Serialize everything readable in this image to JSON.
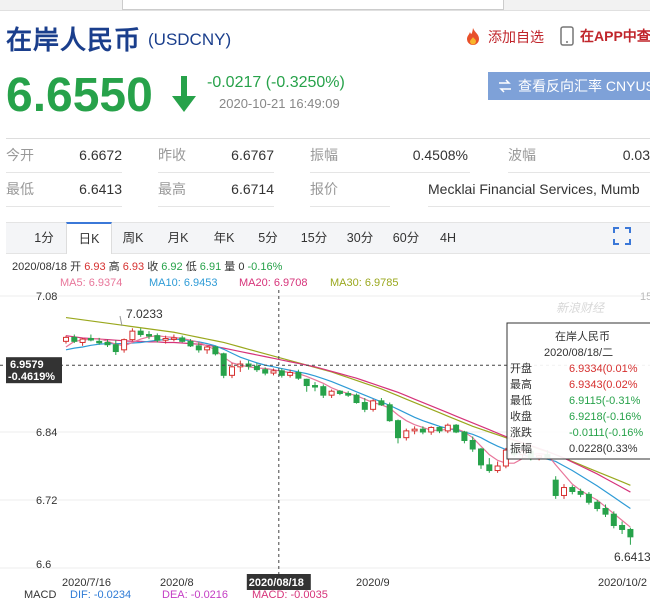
{
  "header": {
    "title": "在岸人民币",
    "code": "(USDCNY)",
    "fav_label": "添加自选",
    "app_label": "在APP中查"
  },
  "quote": {
    "price": "6.6550",
    "change": "-0.0217 (-0.3250%)",
    "time": "2020-10-21 16:49:09",
    "reverse_button": "查看反向汇率 CNYUS",
    "color_down": "#27a24a"
  },
  "stats": [
    [
      {
        "label": "今开",
        "value": "6.6672"
      },
      {
        "label": "昨收",
        "value": "6.6767"
      },
      {
        "label": "振幅",
        "value": "0.4508%"
      },
      {
        "label": "波幅",
        "value": "0.03"
      }
    ],
    [
      {
        "label": "最低",
        "value": "6.6413"
      },
      {
        "label": "最高",
        "value": "6.6714"
      },
      {
        "label": "报价",
        "value": "Mecklai Financial Services, Mumb"
      }
    ]
  ],
  "tabs": [
    "1分",
    "日K",
    "周K",
    "月K",
    "年K",
    "5分",
    "15分",
    "30分",
    "60分",
    "4H"
  ],
  "active_tab": "日K",
  "chart_info": {
    "ohlc_line": {
      "date": "2020/08/18",
      "open_label": "开",
      "open": "6.93",
      "high_label": "高",
      "high": "6.93",
      "close_label": "收",
      "close": "6.92",
      "low_label": "低",
      "low": "6.91",
      "vol_label": "量",
      "vol": "0",
      "pct": "-0.16%"
    },
    "ma": [
      {
        "label": "MA5: 6.9374",
        "color": "#e8769a"
      },
      {
        "label": "MA10: 6.9453",
        "color": "#2e9bd6"
      },
      {
        "label": "MA20: 6.9708",
        "color": "#d6337a"
      },
      {
        "label": "MA30: 6.9785",
        "color": "#9aa81e"
      }
    ],
    "macd": [
      {
        "label": "MACD",
        "color": "#333"
      },
      {
        "label": "DIF: -0.0234",
        "color": "#2e7bd6"
      },
      {
        "label": "DEA: -0.0216",
        "color": "#c43dc4"
      },
      {
        "label": "MACD: -0.0035",
        "color": "#d6337a"
      }
    ],
    "cursor_price": "6.9579",
    "cursor_pct": "-0.4619%",
    "cursor_date": "2020/08/18",
    "max_label": "7.0233",
    "min_label": "6.6413",
    "watermark": "新浪财经",
    "right_edge_label": "15",
    "tooltip": {
      "title": "在岸人民币",
      "date": "2020/08/18/二",
      "rows": [
        {
          "label": "开盘",
          "value": "6.9334(0.01%"
        },
        {
          "label": "最高",
          "value": "6.9343(0.02%"
        },
        {
          "label": "最低",
          "value": "6.9115(-0.31%"
        },
        {
          "label": "收盘",
          "value": "6.9218(-0.16%"
        },
        {
          "label": "涨跌",
          "value": "-0.0111(-0.16%"
        },
        {
          "label": "振幅",
          "value": "0.0228(0.33%"
        }
      ]
    }
  },
  "chart_data": {
    "type": "candlestick",
    "yticks": [
      "7.08",
      "6.84",
      "6.72",
      "6.6"
    ],
    "xticks": [
      "2020/7/16",
      "2020/8",
      "2020/08/18",
      "2020/9",
      "2020/10/2"
    ],
    "ylim": [
      6.6,
      7.08
    ],
    "up_color": "#d6302f",
    "down_color": "#27a24a",
    "candles": [
      [
        7.0,
        7.01,
        6.996,
        7.007
      ],
      [
        7.007,
        7.012,
        6.997,
        7.0
      ],
      [
        6.998,
        7.006,
        6.992,
        7.004
      ],
      [
        7.005,
        7.012,
        7.0,
        7.003
      ],
      [
        7.0,
        7.006,
        6.994,
        6.998
      ],
      [
        6.998,
        7.003,
        6.99,
        6.994
      ],
      [
        6.994,
        7.002,
        6.976,
        6.982
      ],
      [
        6.985,
        7.005,
        6.98,
        7.003
      ],
      [
        7.003,
        7.023,
        7.0,
        7.018
      ],
      [
        7.018,
        7.023,
        7.008,
        7.012
      ],
      [
        7.012,
        7.018,
        7.004,
        7.01
      ],
      [
        7.01,
        7.014,
        6.998,
        7.002
      ],
      [
        7.002,
        7.01,
        6.996,
        7.005
      ],
      [
        7.005,
        7.012,
        7.0,
        7.006
      ],
      [
        7.006,
        7.01,
        6.998,
        7.0
      ],
      [
        7.0,
        7.004,
        6.99,
        6.992
      ],
      [
        6.992,
        6.998,
        6.98,
        6.985
      ],
      [
        6.985,
        6.992,
        6.978,
        6.99
      ],
      [
        6.99,
        6.992,
        6.975,
        6.978
      ],
      [
        6.978,
        6.98,
        6.935,
        6.94
      ],
      [
        6.94,
        6.962,
        6.935,
        6.955
      ],
      [
        6.955,
        6.966,
        6.946,
        6.96
      ],
      [
        6.96,
        6.966,
        6.95,
        6.956
      ],
      [
        6.956,
        6.962,
        6.946,
        6.95
      ],
      [
        6.95,
        6.954,
        6.94,
        6.944
      ],
      [
        6.944,
        6.952,
        6.94,
        6.948
      ],
      [
        6.948,
        6.952,
        6.936,
        6.94
      ],
      [
        6.94,
        6.95,
        6.936,
        6.945
      ],
      [
        6.945,
        6.95,
        6.932,
        6.935
      ],
      [
        6.933,
        6.934,
        6.911,
        6.922
      ],
      [
        6.922,
        6.928,
        6.912,
        6.92
      ],
      [
        6.92,
        6.924,
        6.9,
        6.905
      ],
      [
        6.905,
        6.915,
        6.9,
        6.912
      ],
      [
        6.912,
        6.914,
        6.905,
        6.908
      ],
      [
        6.908,
        6.912,
        6.902,
        6.905
      ],
      [
        6.905,
        6.908,
        6.89,
        6.892
      ],
      [
        6.892,
        6.9,
        6.875,
        6.88
      ],
      [
        6.88,
        6.898,
        6.876,
        6.895
      ],
      [
        6.895,
        6.9,
        6.886,
        6.888
      ],
      [
        6.888,
        6.892,
        6.858,
        6.86
      ],
      [
        6.86,
        6.862,
        6.82,
        6.83
      ],
      [
        6.83,
        6.846,
        6.825,
        6.842
      ],
      [
        6.842,
        6.85,
        6.836,
        6.845
      ],
      [
        6.845,
        6.85,
        6.836,
        6.84
      ],
      [
        6.84,
        6.85,
        6.835,
        6.848
      ],
      [
        6.848,
        6.85,
        6.838,
        6.842
      ],
      [
        6.842,
        6.855,
        6.838,
        6.852
      ],
      [
        6.852,
        6.854,
        6.838,
        6.84
      ],
      [
        6.84,
        6.842,
        6.82,
        6.825
      ],
      [
        6.825,
        6.832,
        6.805,
        6.81
      ],
      [
        6.81,
        6.812,
        6.775,
        6.782
      ],
      [
        6.782,
        6.794,
        6.768,
        6.772
      ],
      [
        6.772,
        6.788,
        6.768,
        6.78
      ],
      [
        6.78,
        6.812,
        6.776,
        6.808
      ],
      [
        6.808,
        6.812,
        6.796,
        6.8
      ],
      [
        6.8,
        6.81,
        6.794,
        6.806
      ],
      [
        6.806,
        6.808,
        6.79,
        6.795
      ],
      [
        6.795,
        6.8,
        6.79,
        6.798
      ],
      [
        6.8,
        6.808,
        6.792,
        6.795
      ],
      [
        6.755,
        6.762,
        6.722,
        6.728
      ],
      [
        6.728,
        6.748,
        6.722,
        6.742
      ],
      [
        6.742,
        6.746,
        6.73,
        6.735
      ],
      [
        6.735,
        6.74,
        6.725,
        6.73
      ],
      [
        6.73,
        6.734,
        6.712,
        6.716
      ],
      [
        6.716,
        6.72,
        6.7,
        6.705
      ],
      [
        6.705,
        6.712,
        6.69,
        6.695
      ],
      [
        6.695,
        6.7,
        6.67,
        6.675
      ],
      [
        6.675,
        6.682,
        6.66,
        6.668
      ],
      [
        6.668,
        6.671,
        6.641,
        6.655
      ]
    ],
    "ma5": [
      6.99,
      7.0,
      7.002,
      7.004,
      7.005,
      7.0,
      6.995,
      6.992,
      6.998,
      7.004,
      7.008,
      7.01,
      7.008,
      7.007,
      7.005,
      7.002,
      6.998,
      6.992,
      6.985,
      6.972,
      6.962,
      6.958,
      6.955,
      6.953,
      6.952,
      6.95,
      6.947,
      6.945,
      6.943,
      6.938,
      6.932,
      6.926,
      6.918,
      6.912,
      6.908,
      6.904,
      6.898,
      6.892,
      6.888,
      6.882,
      6.87,
      6.86,
      6.853,
      6.848,
      6.843,
      6.843,
      6.845,
      6.846,
      6.84,
      6.83,
      6.815,
      6.8,
      6.79,
      6.785,
      6.785,
      6.793,
      6.8,
      6.802,
      6.8,
      6.782,
      6.765,
      6.748,
      6.737,
      6.728,
      6.72,
      6.708,
      6.696,
      6.684,
      6.672
    ],
    "ma10": [
      6.985,
      6.988,
      6.99,
      6.993,
      6.995,
      6.996,
      6.996,
      6.996,
      6.997,
      6.998,
      7.0,
      7.002,
      7.003,
      7.004,
      7.003,
      7.001,
      6.999,
      6.996,
      6.992,
      6.986,
      6.979,
      6.972,
      6.967,
      6.962,
      6.958,
      6.955,
      6.952,
      6.949,
      6.946,
      6.943,
      6.939,
      6.934,
      6.929,
      6.923,
      6.917,
      6.911,
      6.905,
      6.899,
      6.893,
      6.887,
      6.88,
      6.873,
      6.866,
      6.86,
      6.855,
      6.85,
      6.846,
      6.843,
      6.84,
      6.836,
      6.83,
      6.822,
      6.815,
      6.809,
      6.804,
      6.8,
      6.796,
      6.794,
      6.792,
      6.788,
      6.78,
      6.772,
      6.763,
      6.754,
      6.745,
      6.735,
      6.725,
      6.715,
      6.705
    ],
    "ma20": [
      7.01,
      7.008,
      7.006,
      7.005,
      7.004,
      7.003,
      7.002,
      7.001,
      7.0,
      7.0,
      6.999,
      6.999,
      6.998,
      6.998,
      6.997,
      6.996,
      6.995,
      6.993,
      6.991,
      6.988,
      6.985,
      6.982,
      6.979,
      6.976,
      6.973,
      6.97,
      6.967,
      6.964,
      6.961,
      6.958,
      6.955,
      6.951,
      6.947,
      6.943,
      6.939,
      6.935,
      6.93,
      6.925,
      6.92,
      6.915,
      6.91,
      6.904,
      6.898,
      6.892,
      6.886,
      6.88,
      6.874,
      6.868,
      6.862,
      6.856,
      6.85,
      6.844,
      6.838,
      6.832,
      6.826,
      6.821,
      6.816,
      6.811,
      6.806,
      6.8,
      6.794,
      6.787,
      6.78,
      6.773,
      6.766,
      6.758,
      6.75,
      6.742,
      6.734
    ],
    "ma30": [
      7.042,
      7.04,
      7.038,
      7.036,
      7.034,
      7.032,
      7.03,
      7.028,
      7.026,
      7.024,
      7.022,
      7.02,
      7.018,
      7.016,
      7.013,
      7.01,
      7.007,
      7.004,
      7.001,
      6.998,
      6.994,
      6.99,
      6.986,
      6.982,
      6.978,
      6.974,
      6.97,
      6.966,
      6.962,
      6.958,
      6.954,
      6.95,
      6.946,
      6.941,
      6.936,
      6.931,
      6.926,
      6.921,
      6.916,
      6.91,
      6.904,
      6.898,
      6.892,
      6.886,
      6.88,
      6.874,
      6.868,
      6.862,
      6.856,
      6.85,
      6.845,
      6.84,
      6.835,
      6.83,
      6.825,
      6.82,
      6.815,
      6.81,
      6.805,
      6.8,
      6.794,
      6.788,
      6.782,
      6.776,
      6.77,
      6.764,
      6.758,
      6.752,
      6.746
    ]
  }
}
